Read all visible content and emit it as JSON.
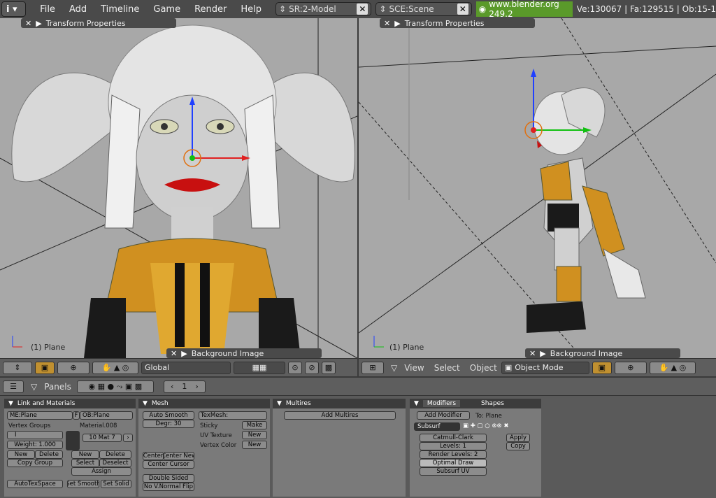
{
  "topbar": {
    "menu": [
      "File",
      "Add",
      "Timeline",
      "Game",
      "Render",
      "Help"
    ],
    "screen": "SR:2-Model",
    "scene": "SCE:Scene",
    "url": "www.blender.org 249.2",
    "stats": "Ve:130067 | Fa:129515 | Ob:15-1"
  },
  "left_view": {
    "transform_panel": "Transform Properties",
    "bg_panel": "Background Image",
    "object_label": "(1) Plane",
    "orientation": "Global"
  },
  "right_view": {
    "transform_panel": "Transform Properties",
    "bg_panel": "Background Image",
    "object_label": "(1) Plane",
    "menu": [
      "View",
      "Select",
      "Object"
    ],
    "mode": "Object Mode"
  },
  "buttons_header": {
    "panels_label": "Panels",
    "frame": "1"
  },
  "link_materials": {
    "title": "Link and Materials",
    "mesh_name": "ME:Plane",
    "f_label": "F",
    "ob_name": "OB:Plane",
    "vertex_groups": "Vertex Groups",
    "material": "Material.008",
    "group_field": "I",
    "weight": "Weight: 1.000",
    "mat_index": "10 Mat 7",
    "new1": "New",
    "delete1": "Delete",
    "new2": "New",
    "delete2": "Delete",
    "copy_group": "Copy Group",
    "select": "Select",
    "deselect": "Deselect",
    "assign": "Assign",
    "autotex": "AutoTexSpace",
    "set_smooth": "Set Smooth",
    "set_solid": "Set Solid"
  },
  "mesh": {
    "title": "Mesh",
    "auto_smooth": "Auto Smooth",
    "degr": "Degr: 30",
    "texmesh": "TexMesh:",
    "sticky": "Sticky",
    "make": "Make",
    "uv_texture": "UV Texture",
    "new_uv": "New",
    "vertex_color": "Vertex Color",
    "new_vc": "New",
    "center": "Center",
    "center_new": "Center New",
    "center_cursor": "Center Cursor",
    "double_sided": "Double Sided",
    "no_vnormal": "No V.Normal Flip"
  },
  "multires": {
    "title": "Multires",
    "add": "Add Multires"
  },
  "modifiers": {
    "tab1": "Modifiers",
    "tab2": "Shapes",
    "add_modifier": "Add Modifier",
    "to": "To: Plane",
    "name": "Subsurf",
    "type": "Catmull-Clark",
    "levels": "Levels: 1",
    "render_levels": "Render Levels: 2",
    "optimal": "Optimal Draw",
    "subsurf_uv": "Subsurf UV",
    "apply": "Apply",
    "copy": "Copy"
  }
}
